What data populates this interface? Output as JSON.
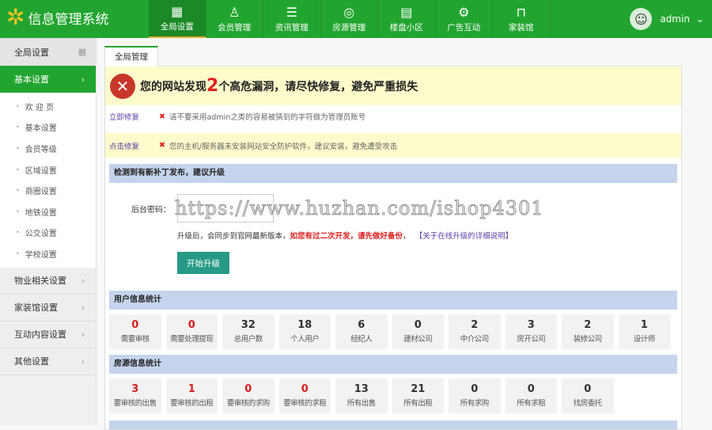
{
  "header": {
    "title": "信息管理系统",
    "user": "admin",
    "nav": [
      {
        "label": "全局设置",
        "icon": "grid-icon",
        "glyph": "▦",
        "active": true
      },
      {
        "label": "会员管理",
        "icon": "user-icon",
        "glyph": "♙"
      },
      {
        "label": "资讯管理",
        "icon": "document-icon",
        "glyph": "☰"
      },
      {
        "label": "房源管理",
        "icon": "camera-icon",
        "glyph": "◎"
      },
      {
        "label": "楼盘小区",
        "icon": "calendar-icon",
        "glyph": "▤"
      },
      {
        "label": "广告互动",
        "icon": "gear-icon",
        "glyph": "⚙"
      },
      {
        "label": "家装馆",
        "icon": "bag-icon",
        "glyph": "⊓"
      }
    ]
  },
  "sidebar": {
    "head": "全局设置",
    "active": "基本设置",
    "sub": [
      "欢 迎 页",
      "基本设置",
      "会员等级",
      "区域设置",
      "商圈设置",
      "地铁设置",
      "公交设置",
      "学校设置"
    ],
    "groups": [
      "物业相关设置",
      "家装馆设置",
      "互动内容设置",
      "其他设置"
    ]
  },
  "main": {
    "tab": "全局管理",
    "alert": {
      "pre": "您的网站发现",
      "num": "2",
      "post": "个高危漏洞，请尽快修复，避免严重损失"
    },
    "issues": [
      {
        "fix": "立即修复",
        "msg": "请不要采用admin之类的容易被猜到的字符做为管理员账号"
      },
      {
        "fix": "点击修复",
        "msg": "您的主机/服务器未安装网站安全防护软件，建议安装，避免遭受攻击"
      }
    ],
    "upgrade": {
      "title": "检测到有新补丁发布，建议升级",
      "label": "后台密码：",
      "note": "升级后，会同步到官网最新版本，",
      "warn": "如您有过二次开发，请先做好备份",
      "comma": "，",
      "link": "【关于在线升级的详细说明】",
      "button": "开始升级"
    },
    "watermark": "https://www.huzhan.com/ishop4301",
    "user_stats": {
      "title": "用户信息统计",
      "items": [
        {
          "v": "0",
          "l": "需要审核",
          "red": true
        },
        {
          "v": "0",
          "l": "需要处理提现",
          "red": true
        },
        {
          "v": "32",
          "l": "总用户数"
        },
        {
          "v": "18",
          "l": "个人用户"
        },
        {
          "v": "6",
          "l": "经纪人"
        },
        {
          "v": "0",
          "l": "建材公司"
        },
        {
          "v": "2",
          "l": "中介公司"
        },
        {
          "v": "3",
          "l": "房开公司"
        },
        {
          "v": "2",
          "l": "装修公司"
        },
        {
          "v": "1",
          "l": "设计师"
        }
      ]
    },
    "house_stats": {
      "title": "房源信息统计",
      "items": [
        {
          "v": "3",
          "l": "要审核的出售",
          "red": true
        },
        {
          "v": "1",
          "l": "要审核的出租",
          "red": true
        },
        {
          "v": "0",
          "l": "要审核的求购",
          "red": true
        },
        {
          "v": "0",
          "l": "要审核的求租",
          "red": true
        },
        {
          "v": "13",
          "l": "所有出售"
        },
        {
          "v": "21",
          "l": "所有出租"
        },
        {
          "v": "0",
          "l": "所有求购"
        },
        {
          "v": "0",
          "l": "所有求租"
        },
        {
          "v": "0",
          "l": "找房委托"
        }
      ]
    }
  }
}
